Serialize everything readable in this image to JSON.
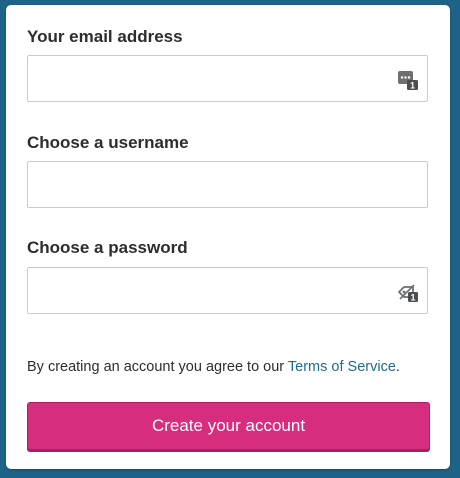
{
  "form": {
    "email_label": "Your email address",
    "email_value": "",
    "username_label": "Choose a username",
    "username_value": "",
    "password_label": "Choose a password",
    "password_value": "",
    "terms_prefix": "By creating an account you agree to our ",
    "terms_link": "Terms of Service",
    "terms_suffix": ".",
    "submit_label": "Create your account",
    "email_icon": "password-manager-autofill-icon",
    "password_icon": "password-key-autofill-icon"
  },
  "colors": {
    "background": "#1d6387",
    "submit_button": "#d62d7f",
    "link": "#1f6a8f"
  }
}
